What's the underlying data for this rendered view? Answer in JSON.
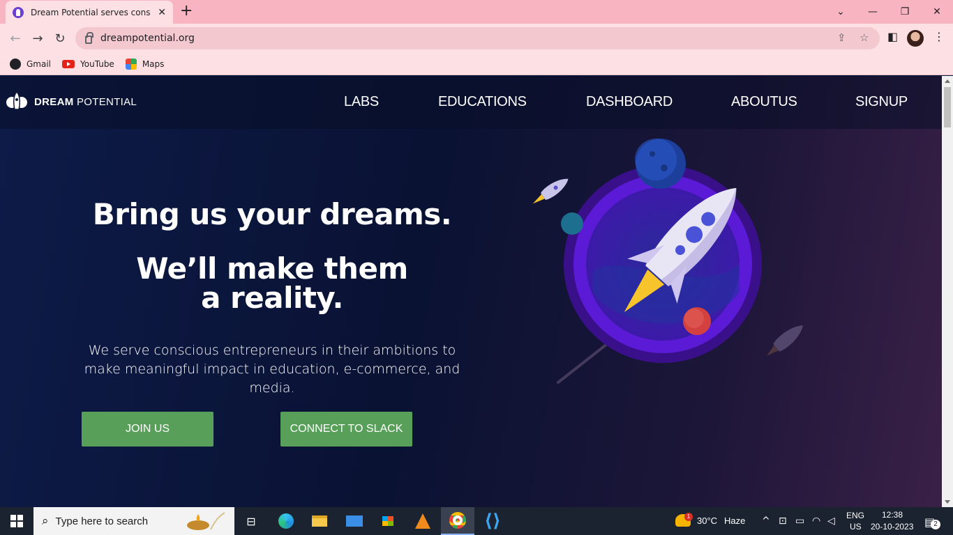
{
  "browser": {
    "tab_title": "Dream Potential serves conscious entrepreneurs",
    "url": "dreampotential.org",
    "bookmarks": [
      {
        "label": "Gmail",
        "icon": "gmail-icon"
      },
      {
        "label": "YouTube",
        "icon": "youtube-icon"
      },
      {
        "label": "Maps",
        "icon": "maps-icon"
      }
    ]
  },
  "site": {
    "logo_bold": "DREAM",
    "logo_light": "POTENTIAL",
    "nav": [
      "LABS",
      "EDUCATIONS",
      "DASHBOARD",
      "ABOUTUS",
      "SIGNUP"
    ],
    "headline_1": "Bring us your dreams.",
    "headline_2": "We’ll make them a reality.",
    "subtext": "We serve conscious entrepreneurs in their ambitions to make meaningful impact in education, e-commerce, and media.",
    "btn_join": "JOIN US",
    "btn_slack": "CONNECT TO SLACK",
    "colors": {
      "button": "#58a05a",
      "planet_ring": "#5b1bd6",
      "background": "#0b1638"
    }
  },
  "taskbar": {
    "search_placeholder": "Type here to search",
    "weather_temp": "30°C",
    "weather_desc": "Haze",
    "weather_badge": "1",
    "lang_1": "ENG",
    "lang_2": "US",
    "time": "12:38",
    "date": "20-10-2023",
    "notification_count": "2"
  }
}
